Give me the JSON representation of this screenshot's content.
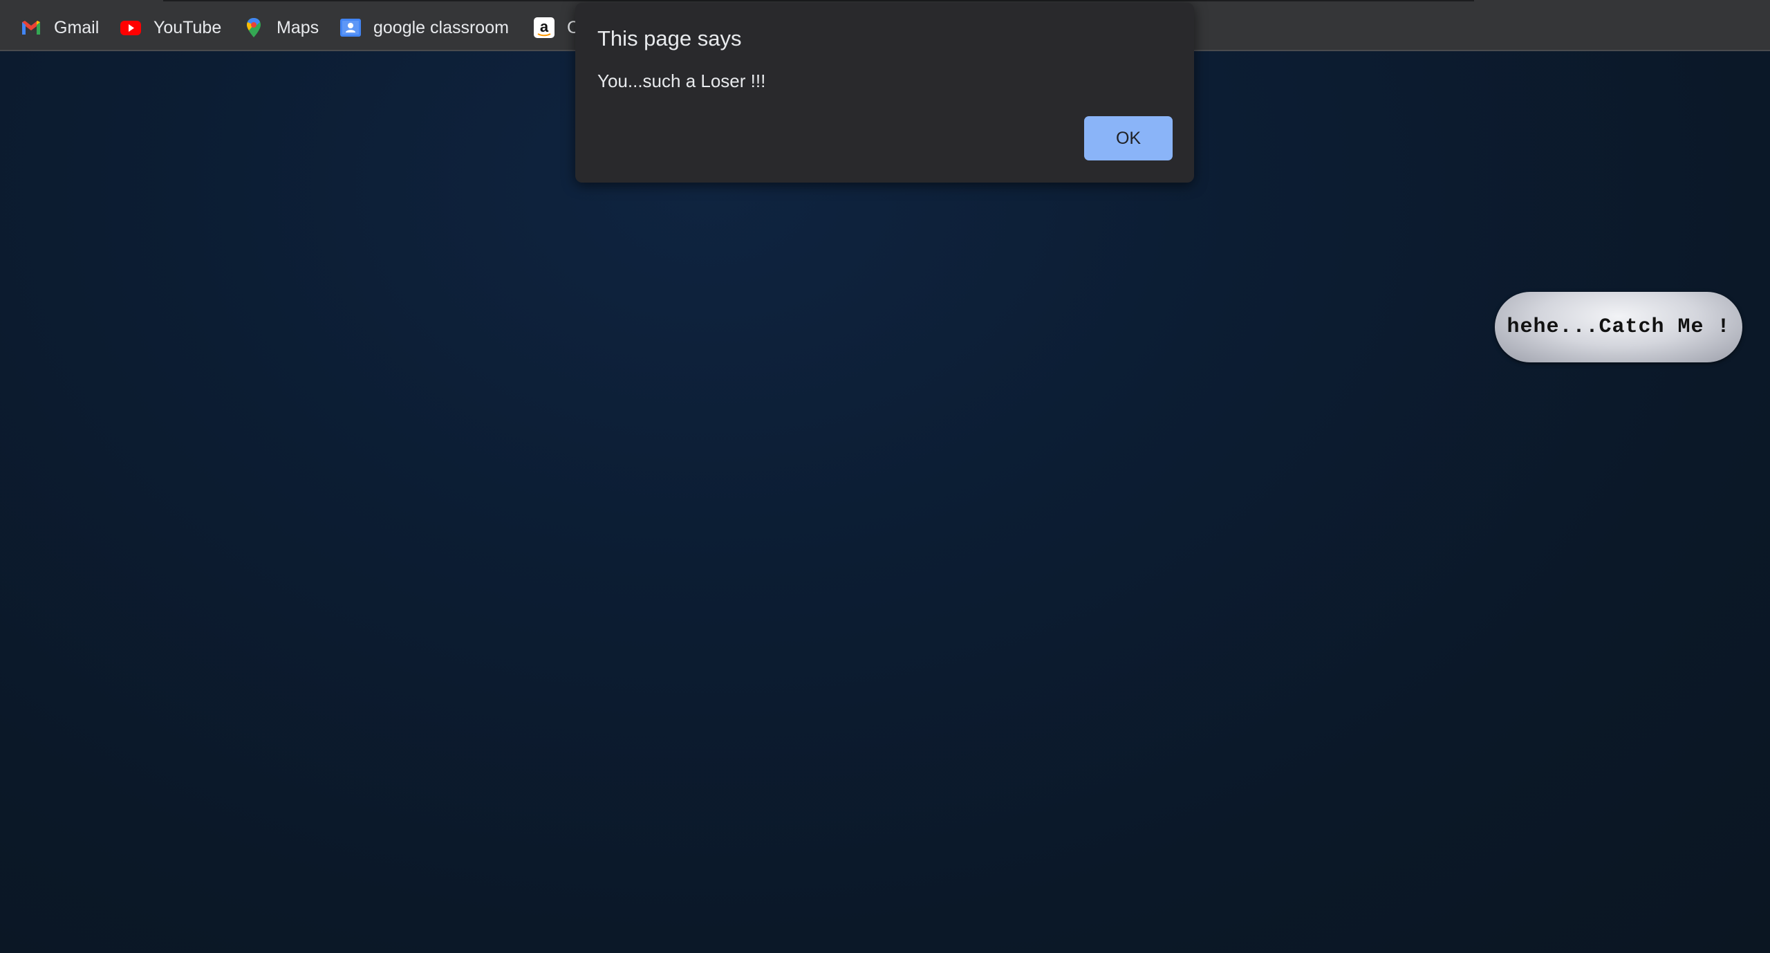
{
  "bookmarks": [
    {
      "label": "Gmail",
      "icon": "gmail-icon"
    },
    {
      "label": "YouTube",
      "icon": "youtube-icon"
    },
    {
      "label": "Maps",
      "icon": "maps-icon"
    },
    {
      "label": "google classroom",
      "icon": "classroom-icon"
    },
    {
      "label": "C",
      "icon": "amazon-icon"
    }
  ],
  "alert": {
    "title": "This page says",
    "message": "You...such a Loser !!!",
    "ok_label": "OK"
  },
  "catch_button": {
    "label": "hehe...Catch Me !"
  },
  "colors": {
    "page_background": "#0c1a2b",
    "bookmarks_bar": "#353638",
    "dialog_background": "#29292c",
    "ok_button": "#8ab4f8"
  }
}
